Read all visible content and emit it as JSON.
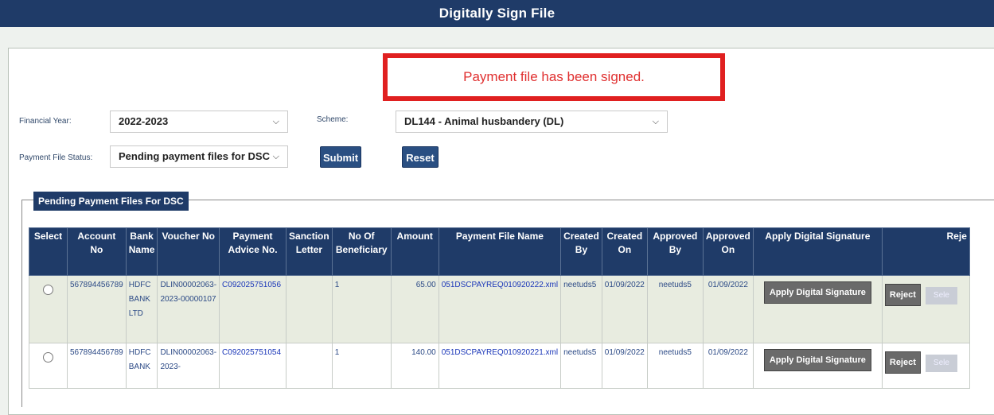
{
  "page": {
    "title": "Digitally Sign File"
  },
  "message": "Payment file has been signed.",
  "filters": {
    "financial_year_label": "Financial Year:",
    "financial_year_value": "2022-2023",
    "scheme_label": "Scheme:",
    "scheme_value": "DL144 - Animal husbandery (DL)",
    "status_label": "Payment File Status:",
    "status_value": "Pending payment files for DSC",
    "submit_label": "Submit",
    "reset_label": "Reset"
  },
  "section": {
    "legend": "Pending Payment Files For DSC"
  },
  "table": {
    "headers": {
      "select": "Select",
      "account_no": "Account No",
      "bank_name": "Bank Name",
      "voucher_no": "Voucher No",
      "payment_advice": "Payment Advice No.",
      "sanction_letter": "Sanction Letter",
      "no_of_beneficiary": "No Of Beneficiary",
      "amount": "Amount",
      "payment_file_name": "Payment File Name",
      "created_by": "Created By",
      "created_on": "Created On",
      "approved_by": "Approved By",
      "approved_on": "Approved On",
      "apply_ds": "Apply Digital Signature",
      "reject": "Reje"
    },
    "rows": [
      {
        "account_no": "567894456789",
        "bank_name": "HDFC BANK LTD",
        "voucher_no": "DLIN00002063-2023-00000107",
        "payment_advice": "C092025751056",
        "sanction_letter": "",
        "no_of_beneficiary": "1",
        "amount": "65.00",
        "payment_file_name": "051DSCPAYREQ010920222.xml",
        "created_by": "neetuds5",
        "created_on": "01/09/2022",
        "approved_by": "neetuds5",
        "approved_on": "01/09/2022",
        "apply_label": "Apply Digital Signature",
        "reject_label": "Reject",
        "extra_label": "Sele"
      },
      {
        "account_no": "567894456789",
        "bank_name": "HDFC BANK",
        "voucher_no": "DLIN00002063-2023-",
        "payment_advice": "C092025751054",
        "sanction_letter": "",
        "no_of_beneficiary": "1",
        "amount": "140.00",
        "payment_file_name": "051DSCPAYREQ010920221.xml",
        "created_by": "neetuds5",
        "created_on": "01/09/2022",
        "approved_by": "neetuds5",
        "approved_on": "01/09/2022",
        "apply_label": "Apply Digital Signature",
        "reject_label": "Reject",
        "extra_label": "Sele"
      }
    ]
  }
}
